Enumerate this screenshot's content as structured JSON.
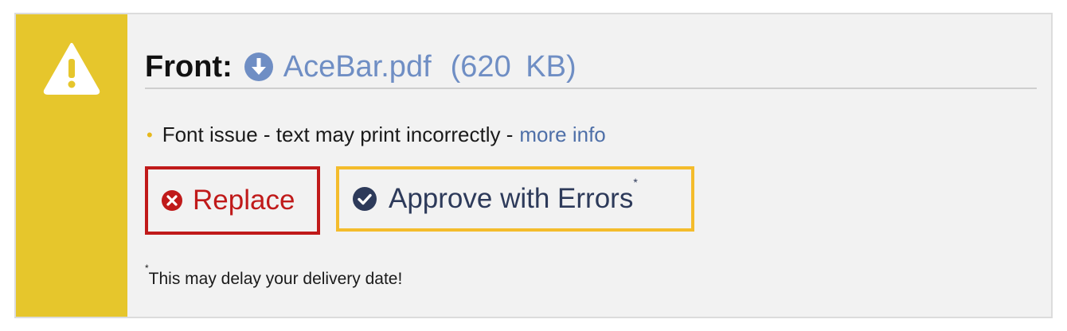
{
  "header": {
    "label": "Front:",
    "file_name": "AceBar.pdf",
    "file_size": "(620  KB)"
  },
  "issue": {
    "text": "Font issue - text may print incorrectly -",
    "link": "more info"
  },
  "actions": {
    "replace_label": "Replace",
    "approve_label": "Approve with Errors",
    "approve_marker": "*"
  },
  "footnote": {
    "marker": "*",
    "text": "This may delay your delivery date!"
  },
  "colors": {
    "stripe": "#e6c62c",
    "link": "#6f8ec4",
    "replace": "#c01a1a",
    "approve_border": "#f4bc2c",
    "approve_text": "#2d3a5a"
  },
  "icons": {
    "alert": "warning-triangle-icon",
    "download": "download-circle-icon",
    "replace": "x-circle-icon",
    "approve": "check-circle-icon"
  }
}
